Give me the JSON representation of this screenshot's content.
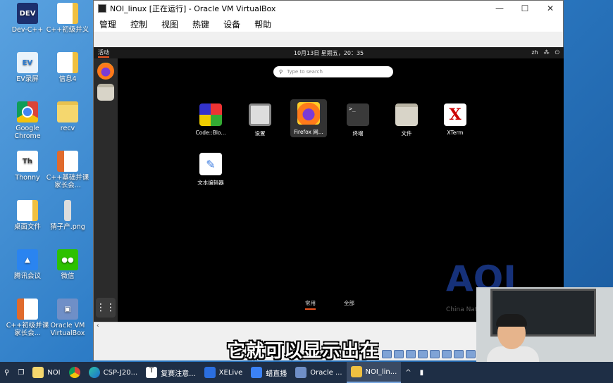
{
  "desktop": {
    "icons": [
      {
        "label": "Dev-C++",
        "icon": "dev-cpp-icon",
        "badge": "DEV"
      },
      {
        "label": "C++初级并义",
        "icon": "document-icon"
      },
      {
        "label": "EV录屏",
        "icon": "ev-recorder-icon"
      },
      {
        "label": "信息4",
        "icon": "document-icon"
      },
      {
        "label": "Google Chrome",
        "icon": "chrome-icon"
      },
      {
        "label": "recv",
        "icon": "folder-icon"
      },
      {
        "label": "Thonny",
        "icon": "thonny-icon",
        "badge": "Th"
      },
      {
        "label": "C++基础并课家长会...",
        "icon": "ppt-icon"
      },
      {
        "label": "桌面文件",
        "icon": "document-icon"
      },
      {
        "label": "猜子产.png",
        "icon": "image-file-icon"
      },
      {
        "label": "腾讯会议",
        "icon": "tencent-meeting-icon"
      },
      {
        "label": "微信",
        "icon": "wechat-icon"
      },
      {
        "label": "C++初级并课家长会...",
        "icon": "ppt-icon"
      },
      {
        "label": "Oracle VM VirtualBox",
        "icon": "virtualbox-icon"
      }
    ]
  },
  "vbox": {
    "title": "NOI_linux [正在运行] - Oracle VM VirtualBox",
    "controls": {
      "minimize": "—",
      "maximize": "☐",
      "close": "✕"
    },
    "menu": [
      "管理",
      "控制",
      "视图",
      "热键",
      "设备",
      "帮助"
    ]
  },
  "guest": {
    "activities": "活动",
    "clock": "10月13日 星期五，20：35",
    "lang": "zh",
    "search_placeholder": "Type to search",
    "apps": [
      {
        "label": "Code::Blo...",
        "icon": "codeblocks-icon"
      },
      {
        "label": "设置",
        "icon": "settings-gear-icon"
      },
      {
        "label": "Firefox 网...",
        "icon": "firefox-icon"
      },
      {
        "label": "终端",
        "icon": "terminal-icon",
        "glyph": ">_"
      },
      {
        "label": "文件",
        "icon": "files-icon"
      },
      {
        "label": "XTerm",
        "icon": "xterm-icon",
        "glyph": "X"
      },
      {
        "label": "文本编辑器",
        "icon": "text-editor-icon",
        "glyph": "✎"
      }
    ],
    "tabs": [
      "常用",
      "全部"
    ],
    "watermark": "AOI",
    "watermark_sub": "China Nati..."
  },
  "subtitle": "它就可以显示出在",
  "taskbar": {
    "items": [
      {
        "label": "NOI",
        "icon": "folder-icon"
      },
      {
        "label": "",
        "icon": "chrome-icon"
      },
      {
        "label": "CSP-J20...",
        "icon": "edge-icon"
      },
      {
        "label": "复赛注意...",
        "icon": "typora-icon"
      },
      {
        "label": "XELive",
        "icon": "xelive-icon"
      },
      {
        "label": "蜡直播",
        "icon": "live-icon"
      },
      {
        "label": "Oracle ...",
        "icon": "virtualbox-icon"
      },
      {
        "label": "NOI_lin...",
        "icon": "virtualbox-vm-icon"
      }
    ]
  }
}
